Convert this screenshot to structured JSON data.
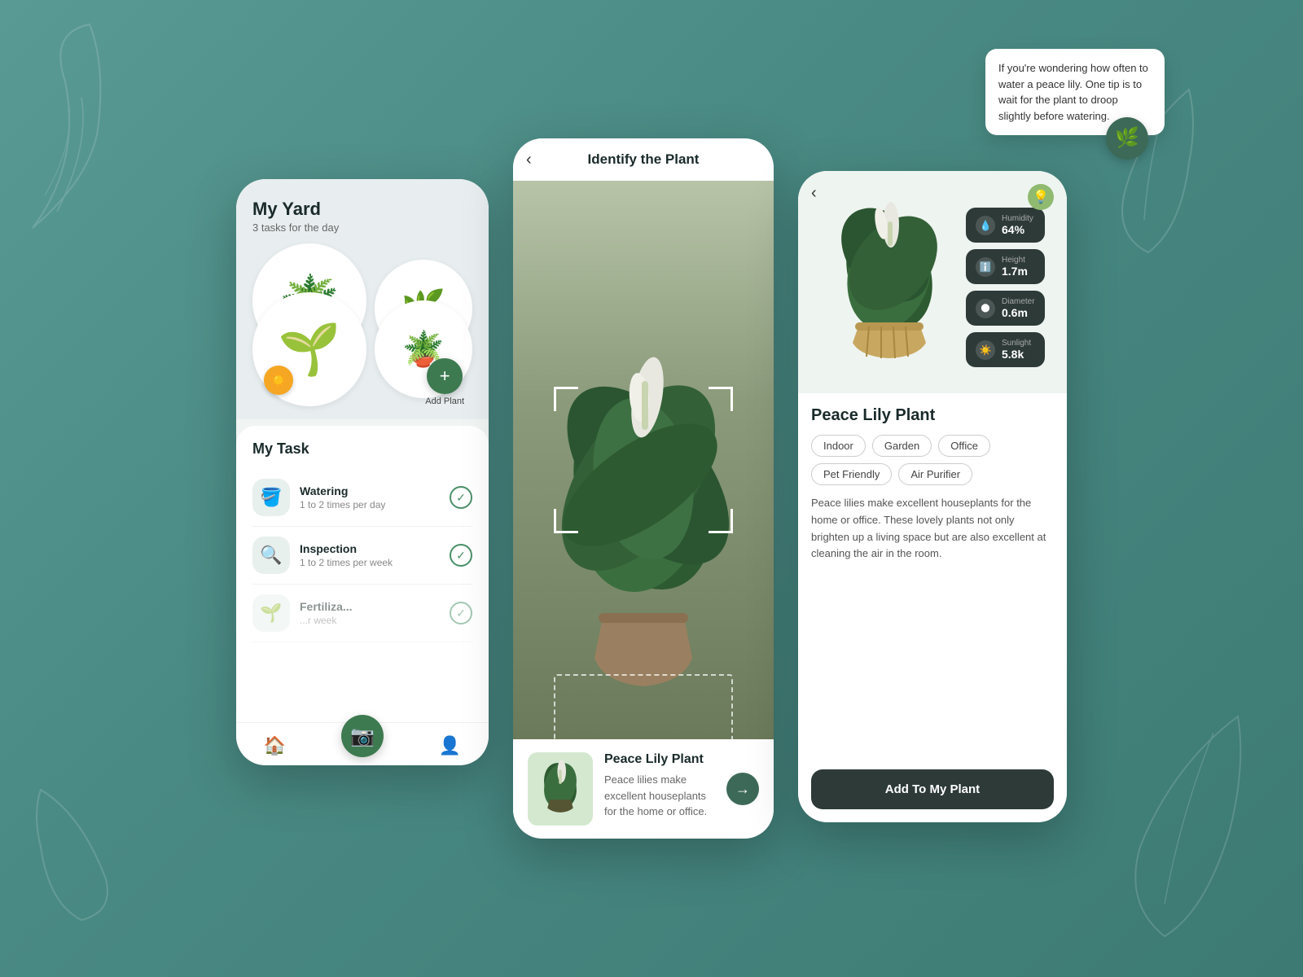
{
  "background": {
    "color": "#4a8a84"
  },
  "tooltip": {
    "text": "If you're wondering how often to water a peace lily. One tip is to wait for the plant to droop slightly before watering.",
    "icon": "🌿"
  },
  "phone1": {
    "title": "My Yard",
    "subtitle": "3 tasks for the day",
    "add_plant_label": "Add Plant",
    "task_section_title": "My Task",
    "tasks": [
      {
        "name": "Watering",
        "freq": "1 to 2 times per day",
        "icon": "🪣"
      },
      {
        "name": "Inspection",
        "freq": "1 to 2 times per week",
        "icon": "🔍"
      },
      {
        "name": "Fertiliza...",
        "freq": "...r week",
        "icon": "🌱"
      }
    ],
    "nav": {
      "home_label": "",
      "scan_label": "",
      "profile_label": ""
    }
  },
  "phone2": {
    "header_title": "Identify the Plant",
    "plant_name": "Peace Lily Plant",
    "plant_desc": "Peace lilies make excellent houseplants for the home or office."
  },
  "phone3": {
    "plant_name": "Peace Lily Plant",
    "stats": [
      {
        "label": "Humidity",
        "value": "64%",
        "icon": "💧"
      },
      {
        "label": "Height",
        "value": "1.7m",
        "icon": "ℹ️"
      },
      {
        "label": "Diameter",
        "value": "0.6m",
        "icon": "🔵"
      },
      {
        "label": "Sunlight",
        "value": "5.8k",
        "icon": "☀️"
      }
    ],
    "tags": [
      "Indoor",
      "Garden",
      "Office",
      "Pet Friendly",
      "Air Purifier"
    ],
    "description": "Peace lilies make excellent houseplants for the home or office. These lovely plants not only brighten up a living space but are also excellent at cleaning the air in the room.",
    "add_button_label": "Add To My Plant"
  }
}
